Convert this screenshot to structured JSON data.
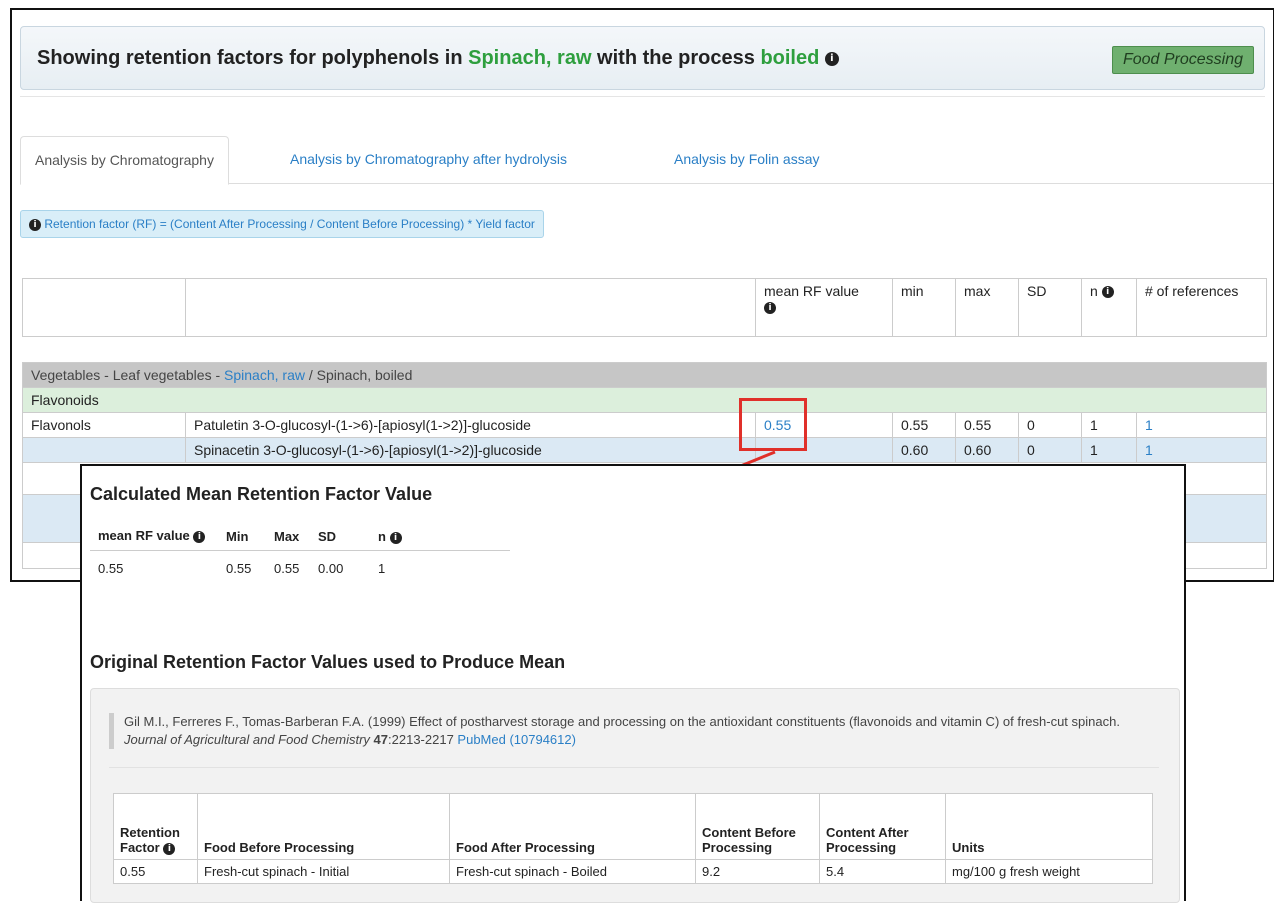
{
  "header": {
    "prefix": "Showing retention factors for polyphenols in ",
    "food": "Spinach, raw",
    "middle": " with the process ",
    "process": "boiled",
    "info_icon": "info-circle-icon",
    "badge": "Food Processing"
  },
  "tabs": [
    {
      "label": "Analysis by Chromatography",
      "active": true
    },
    {
      "label": "Analysis by Chromatography after hydrolysis",
      "active": false
    },
    {
      "label": "Analysis by Folin assay",
      "active": false
    }
  ],
  "formula": "Retention factor (RF) = (Content After Processing / Content Before Processing) * Yield factor",
  "table": {
    "headers": [
      "",
      "",
      "mean RF value",
      "min",
      "max",
      "SD",
      "n",
      "# of references"
    ],
    "group": {
      "prefix": "Vegetables - Leaf vegetables - ",
      "food": "Spinach, raw",
      "suffix": " / Spinach, boiled"
    },
    "class_label": "Flavonoids",
    "row1": {
      "subclass": "Flavonols",
      "compound": "Patuletin 3-O-glucosyl-(1->6)-[apiosyl(1->2)]-glucoside",
      "mean": "0.55",
      "min": "0.55",
      "max": "0.55",
      "sd": "0",
      "n": "1",
      "refs": "1"
    },
    "row2": {
      "compound": "Spinacetin 3-O-glucosyl-(1->6)-[apiosyl(1->2)]-glucoside",
      "min": "0.60",
      "max": "0.60",
      "sd": "0",
      "n": "1",
      "refs": "1"
    }
  },
  "popup": {
    "title": "Calculated Mean Retention Factor Value",
    "mean_table": {
      "headers": [
        "mean RF value",
        "Min",
        "Max",
        "SD",
        "n"
      ],
      "values": [
        "0.55",
        "0.55",
        "0.55",
        "0.00",
        "1"
      ]
    },
    "original_title": "Original Retention Factor Values used to Produce Mean",
    "citation": {
      "authors": "Gil M.I., Ferreres F., Tomas-Barberan F.A. (1999) Effect of postharvest storage and processing on the antioxidant constituents (flavonoids and vitamin C) of fresh-cut spinach. ",
      "journal": "Journal of Agricultural and Food Chemistry",
      "volume": "47",
      "pages": ":2213-2217 ",
      "pubmed": "PubMed (10794612)"
    },
    "ref_table": {
      "headers": [
        "Retention Factor",
        "Food Before Processing",
        "Food After Processing",
        "Content Before Processing",
        "Content After Processing",
        "Units"
      ],
      "row": [
        "0.55",
        "Fresh-cut spinach - Initial",
        "Fresh-cut spinach - Boiled",
        "9.2",
        "5.4",
        "mg/100 g fresh weight"
      ]
    }
  }
}
